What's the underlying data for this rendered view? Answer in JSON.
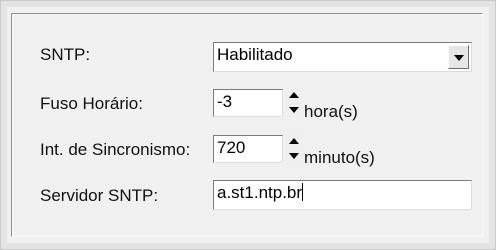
{
  "form": {
    "sntp": {
      "label": "SNTP:",
      "value": "Habilitado"
    },
    "timezone": {
      "label": "Fuso Horário:",
      "value": "-3",
      "unit": "hora(s)"
    },
    "sync_interval": {
      "label": "Int. de Sincronismo:",
      "value": "720",
      "unit": "minuto(s)"
    },
    "server": {
      "label": "Servidor SNTP:",
      "value": "a.st1.ntp.br"
    }
  },
  "icons": {
    "dropdown": "chevron-down-icon",
    "spin_up": "arrow-up-icon",
    "spin_down": "arrow-down-icon"
  }
}
